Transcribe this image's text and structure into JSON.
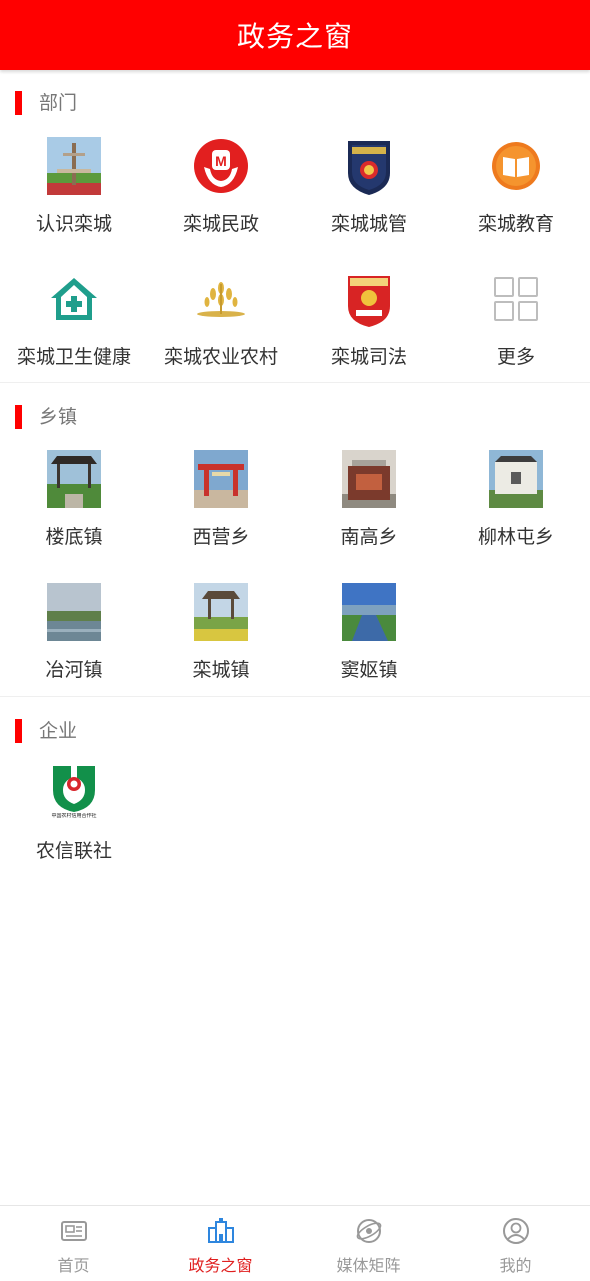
{
  "header": {
    "title": "政务之窗"
  },
  "sections": [
    {
      "title": "部门",
      "items": [
        {
          "label": "认识栾城",
          "icon": "tower-photo-icon"
        },
        {
          "label": "栾城民政",
          "icon": "civil-affairs-emblem-icon"
        },
        {
          "label": "栾城城管",
          "icon": "urban-management-badge-icon"
        },
        {
          "label": "栾城教育",
          "icon": "book-icon"
        },
        {
          "label": "栾城卫生健康",
          "icon": "health-house-icon"
        },
        {
          "label": "栾城农业农村",
          "icon": "wheat-icon"
        },
        {
          "label": "栾城司法",
          "icon": "judicial-emblem-icon"
        },
        {
          "label": "更多",
          "icon": "grid-more-icon"
        }
      ]
    },
    {
      "title": "乡镇",
      "items": [
        {
          "label": "楼底镇",
          "icon": "pavilion-photo-icon"
        },
        {
          "label": "西营乡",
          "icon": "gate-photo-icon"
        },
        {
          "label": "南高乡",
          "icon": "monument-photo-icon"
        },
        {
          "label": "柳林屯乡",
          "icon": "village-wall-photo-icon"
        },
        {
          "label": "冶河镇",
          "icon": "river-photo-icon"
        },
        {
          "label": "栾城镇",
          "icon": "garden-pavilion-photo-icon"
        },
        {
          "label": "窦妪镇",
          "icon": "canal-photo-icon"
        }
      ]
    },
    {
      "title": "企业",
      "items": [
        {
          "label": "农信联社",
          "icon": "rural-credit-logo-icon",
          "logo_text": "中国农村信用合作社"
        }
      ]
    }
  ],
  "tabbar": {
    "items": [
      {
        "label": "首页",
        "icon": "news-icon",
        "active": false
      },
      {
        "label": "政务之窗",
        "icon": "government-building-icon",
        "active": true
      },
      {
        "label": "媒体矩阵",
        "icon": "globe-orbit-icon",
        "active": false
      },
      {
        "label": "我的",
        "icon": "user-icon",
        "active": false
      }
    ]
  },
  "colors": {
    "brand_red": "#ff0000",
    "active_tab": "#e02020",
    "inactive_tab": "#999999"
  }
}
